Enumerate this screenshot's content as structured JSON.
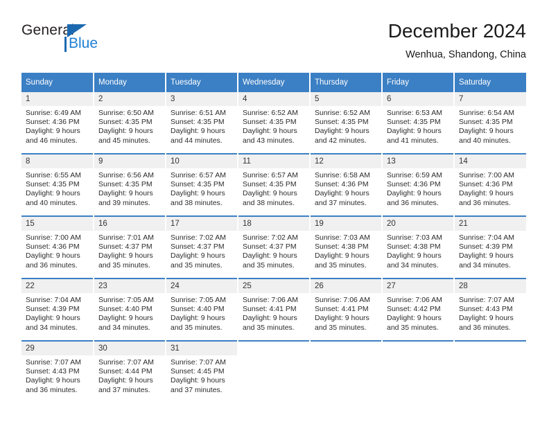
{
  "brand": {
    "name_part1": "General",
    "name_part2": "Blue",
    "accent_color": "#1f7fd4",
    "triangle_color": "#1c69b0"
  },
  "header": {
    "title": "December 2024",
    "subtitle": "Wenhua, Shandong, China"
  },
  "calendar": {
    "header_bg": "#3b7fc4",
    "daynum_bg": "#f0f0f0",
    "weekdays": [
      "Sunday",
      "Monday",
      "Tuesday",
      "Wednesday",
      "Thursday",
      "Friday",
      "Saturday"
    ],
    "weeks": [
      [
        {
          "day": "1",
          "sunrise": "Sunrise: 6:49 AM",
          "sunset": "Sunset: 4:36 PM",
          "daylight1": "Daylight: 9 hours",
          "daylight2": "and 46 minutes."
        },
        {
          "day": "2",
          "sunrise": "Sunrise: 6:50 AM",
          "sunset": "Sunset: 4:35 PM",
          "daylight1": "Daylight: 9 hours",
          "daylight2": "and 45 minutes."
        },
        {
          "day": "3",
          "sunrise": "Sunrise: 6:51 AM",
          "sunset": "Sunset: 4:35 PM",
          "daylight1": "Daylight: 9 hours",
          "daylight2": "and 44 minutes."
        },
        {
          "day": "4",
          "sunrise": "Sunrise: 6:52 AM",
          "sunset": "Sunset: 4:35 PM",
          "daylight1": "Daylight: 9 hours",
          "daylight2": "and 43 minutes."
        },
        {
          "day": "5",
          "sunrise": "Sunrise: 6:52 AM",
          "sunset": "Sunset: 4:35 PM",
          "daylight1": "Daylight: 9 hours",
          "daylight2": "and 42 minutes."
        },
        {
          "day": "6",
          "sunrise": "Sunrise: 6:53 AM",
          "sunset": "Sunset: 4:35 PM",
          "daylight1": "Daylight: 9 hours",
          "daylight2": "and 41 minutes."
        },
        {
          "day": "7",
          "sunrise": "Sunrise: 6:54 AM",
          "sunset": "Sunset: 4:35 PM",
          "daylight1": "Daylight: 9 hours",
          "daylight2": "and 40 minutes."
        }
      ],
      [
        {
          "day": "8",
          "sunrise": "Sunrise: 6:55 AM",
          "sunset": "Sunset: 4:35 PM",
          "daylight1": "Daylight: 9 hours",
          "daylight2": "and 40 minutes."
        },
        {
          "day": "9",
          "sunrise": "Sunrise: 6:56 AM",
          "sunset": "Sunset: 4:35 PM",
          "daylight1": "Daylight: 9 hours",
          "daylight2": "and 39 minutes."
        },
        {
          "day": "10",
          "sunrise": "Sunrise: 6:57 AM",
          "sunset": "Sunset: 4:35 PM",
          "daylight1": "Daylight: 9 hours",
          "daylight2": "and 38 minutes."
        },
        {
          "day": "11",
          "sunrise": "Sunrise: 6:57 AM",
          "sunset": "Sunset: 4:35 PM",
          "daylight1": "Daylight: 9 hours",
          "daylight2": "and 38 minutes."
        },
        {
          "day": "12",
          "sunrise": "Sunrise: 6:58 AM",
          "sunset": "Sunset: 4:36 PM",
          "daylight1": "Daylight: 9 hours",
          "daylight2": "and 37 minutes."
        },
        {
          "day": "13",
          "sunrise": "Sunrise: 6:59 AM",
          "sunset": "Sunset: 4:36 PM",
          "daylight1": "Daylight: 9 hours",
          "daylight2": "and 36 minutes."
        },
        {
          "day": "14",
          "sunrise": "Sunrise: 7:00 AM",
          "sunset": "Sunset: 4:36 PM",
          "daylight1": "Daylight: 9 hours",
          "daylight2": "and 36 minutes."
        }
      ],
      [
        {
          "day": "15",
          "sunrise": "Sunrise: 7:00 AM",
          "sunset": "Sunset: 4:36 PM",
          "daylight1": "Daylight: 9 hours",
          "daylight2": "and 36 minutes."
        },
        {
          "day": "16",
          "sunrise": "Sunrise: 7:01 AM",
          "sunset": "Sunset: 4:37 PM",
          "daylight1": "Daylight: 9 hours",
          "daylight2": "and 35 minutes."
        },
        {
          "day": "17",
          "sunrise": "Sunrise: 7:02 AM",
          "sunset": "Sunset: 4:37 PM",
          "daylight1": "Daylight: 9 hours",
          "daylight2": "and 35 minutes."
        },
        {
          "day": "18",
          "sunrise": "Sunrise: 7:02 AM",
          "sunset": "Sunset: 4:37 PM",
          "daylight1": "Daylight: 9 hours",
          "daylight2": "and 35 minutes."
        },
        {
          "day": "19",
          "sunrise": "Sunrise: 7:03 AM",
          "sunset": "Sunset: 4:38 PM",
          "daylight1": "Daylight: 9 hours",
          "daylight2": "and 35 minutes."
        },
        {
          "day": "20",
          "sunrise": "Sunrise: 7:03 AM",
          "sunset": "Sunset: 4:38 PM",
          "daylight1": "Daylight: 9 hours",
          "daylight2": "and 34 minutes."
        },
        {
          "day": "21",
          "sunrise": "Sunrise: 7:04 AM",
          "sunset": "Sunset: 4:39 PM",
          "daylight1": "Daylight: 9 hours",
          "daylight2": "and 34 minutes."
        }
      ],
      [
        {
          "day": "22",
          "sunrise": "Sunrise: 7:04 AM",
          "sunset": "Sunset: 4:39 PM",
          "daylight1": "Daylight: 9 hours",
          "daylight2": "and 34 minutes."
        },
        {
          "day": "23",
          "sunrise": "Sunrise: 7:05 AM",
          "sunset": "Sunset: 4:40 PM",
          "daylight1": "Daylight: 9 hours",
          "daylight2": "and 34 minutes."
        },
        {
          "day": "24",
          "sunrise": "Sunrise: 7:05 AM",
          "sunset": "Sunset: 4:40 PM",
          "daylight1": "Daylight: 9 hours",
          "daylight2": "and 35 minutes."
        },
        {
          "day": "25",
          "sunrise": "Sunrise: 7:06 AM",
          "sunset": "Sunset: 4:41 PM",
          "daylight1": "Daylight: 9 hours",
          "daylight2": "and 35 minutes."
        },
        {
          "day": "26",
          "sunrise": "Sunrise: 7:06 AM",
          "sunset": "Sunset: 4:41 PM",
          "daylight1": "Daylight: 9 hours",
          "daylight2": "and 35 minutes."
        },
        {
          "day": "27",
          "sunrise": "Sunrise: 7:06 AM",
          "sunset": "Sunset: 4:42 PM",
          "daylight1": "Daylight: 9 hours",
          "daylight2": "and 35 minutes."
        },
        {
          "day": "28",
          "sunrise": "Sunrise: 7:07 AM",
          "sunset": "Sunset: 4:43 PM",
          "daylight1": "Daylight: 9 hours",
          "daylight2": "and 36 minutes."
        }
      ],
      [
        {
          "day": "29",
          "sunrise": "Sunrise: 7:07 AM",
          "sunset": "Sunset: 4:43 PM",
          "daylight1": "Daylight: 9 hours",
          "daylight2": "and 36 minutes."
        },
        {
          "day": "30",
          "sunrise": "Sunrise: 7:07 AM",
          "sunset": "Sunset: 4:44 PM",
          "daylight1": "Daylight: 9 hours",
          "daylight2": "and 37 minutes."
        },
        {
          "day": "31",
          "sunrise": "Sunrise: 7:07 AM",
          "sunset": "Sunset: 4:45 PM",
          "daylight1": "Daylight: 9 hours",
          "daylight2": "and 37 minutes."
        },
        {
          "day": "",
          "sunrise": "",
          "sunset": "",
          "daylight1": "",
          "daylight2": ""
        },
        {
          "day": "",
          "sunrise": "",
          "sunset": "",
          "daylight1": "",
          "daylight2": ""
        },
        {
          "day": "",
          "sunrise": "",
          "sunset": "",
          "daylight1": "",
          "daylight2": ""
        },
        {
          "day": "",
          "sunrise": "",
          "sunset": "",
          "daylight1": "",
          "daylight2": ""
        }
      ]
    ]
  }
}
